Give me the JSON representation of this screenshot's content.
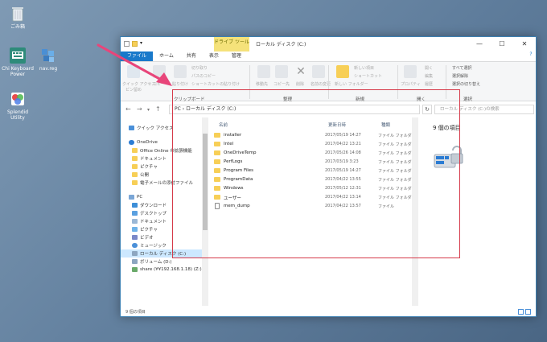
{
  "desktop": {
    "icons": [
      {
        "label": "ごみ箱"
      },
      {
        "label": "Chi Keyboard Power"
      },
      {
        "label": "nav.reg"
      },
      {
        "label": "Splendid Utility"
      }
    ]
  },
  "window": {
    "title": "ローカル ディスク (C:)",
    "context_tab": "ドライブ ツール",
    "controls": {
      "minimize": "—",
      "maximize": "☐",
      "close": "✕"
    },
    "tabs": [
      "ファイル",
      "ホーム",
      "共有",
      "表示",
      "管理"
    ],
    "ribbon": {
      "groups": [
        "クリップボード",
        "整理",
        "新規",
        "開く",
        "選択"
      ],
      "items": {
        "quick_access": "クイック アクセス",
        "pin": "ピン留め",
        "copy": "コピー",
        "paste": "貼り付け",
        "cut": "切り取り",
        "copy_path": "パスのコピー",
        "paste_shortcut": "ショートカットの貼り付け",
        "move_to": "移動先",
        "copy_to": "コピー先",
        "delete": "削除",
        "rename": "名前の変更",
        "new_folder": "新しい\nフォルダー",
        "new_item": "新しい項目",
        "shortcut": "ショートカット",
        "properties": "プロパティ",
        "open": "開く",
        "edit": "編集",
        "history": "履歴",
        "select_all": "すべて選択",
        "select_none": "選択解除",
        "invert": "選択の切り替え"
      }
    },
    "address": {
      "path": "PC  ›  ローカル ディスク (C:)",
      "search_placeholder": "ローカル ディスク (C:)の検索"
    },
    "nav": [
      {
        "label": "クイック アクセス"
      },
      {
        "label": "OneDrive"
      },
      {
        "label": "Office Online の拡張機能"
      },
      {
        "label": "ドキュメント"
      },
      {
        "label": "ピクチャ"
      },
      {
        "label": "公開"
      },
      {
        "label": "電子メールの添付ファイル"
      },
      {
        "label": "PC"
      },
      {
        "label": "ダウンロード"
      },
      {
        "label": "デスクトップ"
      },
      {
        "label": "ドキュメント"
      },
      {
        "label": "ピクチャ"
      },
      {
        "label": "ビデオ"
      },
      {
        "label": "ミュージック"
      },
      {
        "label": "ローカル ディスク (C:)"
      },
      {
        "label": "ボリューム (D:)"
      },
      {
        "label": "share (¥¥192.168.1.18) (Z:)"
      }
    ],
    "columns": {
      "name": "名前",
      "date": "更新日時",
      "type": "種類"
    },
    "files": [
      {
        "name": "installer",
        "date": "2017/05/19 14:27",
        "type": "ファイル フォルダー",
        "kind": "folder"
      },
      {
        "name": "Intel",
        "date": "2017/04/22 13:21",
        "type": "ファイル フォルダー",
        "kind": "folder"
      },
      {
        "name": "OneDriveTemp",
        "date": "2017/05/26 14:08",
        "type": "ファイル フォルダー",
        "kind": "folder"
      },
      {
        "name": "PerfLogs",
        "date": "2017/03/19 3:23",
        "type": "ファイル フォルダー",
        "kind": "folder"
      },
      {
        "name": "Program Files",
        "date": "2017/05/19 14:27",
        "type": "ファイル フォルダー",
        "kind": "folder"
      },
      {
        "name": "ProgramData",
        "date": "2017/04/22 13:55",
        "type": "ファイル フォルダー",
        "kind": "folder"
      },
      {
        "name": "Windows",
        "date": "2017/05/12 12:31",
        "type": "ファイル フォルダー",
        "kind": "folder"
      },
      {
        "name": "ユーザー",
        "date": "2017/04/22 13:14",
        "type": "ファイル フォルダー",
        "kind": "folder"
      },
      {
        "name": "mem_dump",
        "date": "2017/04/22 13:57",
        "type": "ファイル",
        "kind": "file"
      }
    ],
    "details": {
      "count": "9 個の項目"
    },
    "status": "9 個の項目"
  },
  "colors": {
    "accent": "#1979ca",
    "highlight": "#d63a4a",
    "arrow": "#e8457a",
    "folder": "#f7cf57"
  }
}
